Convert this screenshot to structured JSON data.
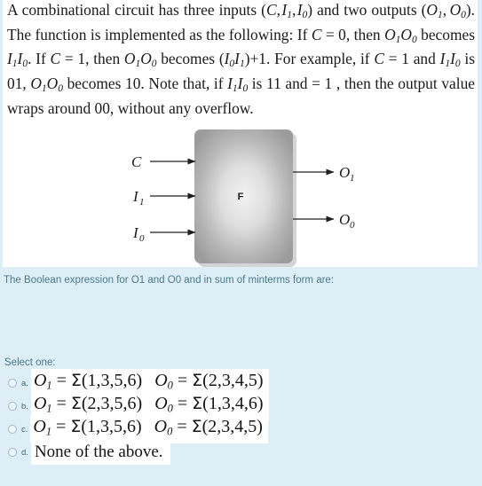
{
  "stem": {
    "paragraph_plain": "A combinational circuit has three inputs (C, I1, I0) and two outputs (O1, O0). The function is implemented as the following: If C = 0, then O1O0 becomes I1I0. If C = 1, then O1O0 becomes (I0I1)+1. For example, if C = 1 and I1I0 is 01, O1O0 becomes 10. Note that, if I1I0 is 11 and = 1 , then the output value wraps around 00, without any overflow."
  },
  "diagram": {
    "box_label": "F",
    "inputs": [
      {
        "name": "C",
        "base": "C",
        "sub": ""
      },
      {
        "name": "I1",
        "base": "I",
        "sub": "1"
      },
      {
        "name": "I0",
        "base": "I",
        "sub": "0"
      }
    ],
    "outputs": [
      {
        "name": "O1",
        "base": "O",
        "sub": "1"
      },
      {
        "name": "O0",
        "base": "O",
        "sub": "0"
      }
    ]
  },
  "prompt": {
    "text": "The Boolean expression for O1 and O0 and  in sum of minterms form are:"
  },
  "question": {
    "select_label": "Select one:",
    "options": [
      {
        "letter": "a.",
        "o1_var": "O",
        "o1_sub": "1",
        "o1_eq": "=",
        "o1_sigma": "Σ",
        "o1_terms": "(1,3,5,6)",
        "o0_var": "O",
        "o0_sub": "0",
        "o0_eq": "=",
        "o0_sigma": "Σ",
        "o0_terms": "(2,3,4,5)",
        "plain": "",
        "selected": false
      },
      {
        "letter": "b.",
        "o1_var": "O",
        "o1_sub": "1",
        "o1_eq": "=",
        "o1_sigma": "Σ",
        "o1_terms": "(2,3,5,6)",
        "o0_var": "O",
        "o0_sub": "0",
        "o0_eq": "=",
        "o0_sigma": "Σ",
        "o0_terms": "(1,3,4,6)",
        "plain": "",
        "selected": false
      },
      {
        "letter": "c.",
        "o1_var": "O",
        "o1_sub": "1",
        "o1_eq": "=",
        "o1_sigma": "Σ",
        "o1_terms": "(1,3,5,6)",
        "o0_var": "O",
        "o0_sub": "0",
        "o0_eq": "=",
        "o0_sigma": "Σ",
        "o0_terms": "(2,3,4,5)",
        "plain": "",
        "selected": false
      },
      {
        "letter": "d.",
        "o1_var": "",
        "o1_sub": "",
        "o1_eq": "",
        "o1_sigma": "",
        "o1_terms": "",
        "o0_var": "",
        "o0_sub": "",
        "o0_eq": "",
        "o0_sigma": "",
        "o0_terms": "",
        "plain": "None of the above.",
        "selected": false
      }
    ]
  },
  "colors": {
    "page_background": "#ddeef6",
    "card_background": "#ffffff",
    "prompt_text": "#4a7a8c",
    "body_text": "#1a1a1a"
  }
}
